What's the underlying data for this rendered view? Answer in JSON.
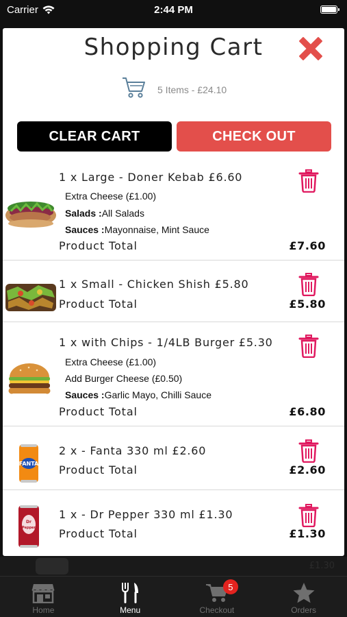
{
  "status_bar": {
    "carrier": "Carrier",
    "time": "2:44 PM"
  },
  "cart": {
    "title": "Shopping Cart",
    "summary": "5 Items - £24.10",
    "clear_label": "CLEAR CART",
    "checkout_label": "CHECK OUT"
  },
  "items": [
    {
      "title": "1 x Large - Doner Kebab £6.60",
      "options": [
        {
          "label": "",
          "value": "Extra Cheese (£1.00)"
        },
        {
          "label": "Salads :",
          "value": "All Salads"
        },
        {
          "label": "Sauces :",
          "value": "Mayonnaise, Mint Sauce"
        }
      ],
      "total_label": "Product Total",
      "total": "£7.60"
    },
    {
      "title": "1 x Small - Chicken Shish £5.80",
      "options": [],
      "total_label": "Product Total",
      "total": "£5.80"
    },
    {
      "title": "1 x with Chips - 1/4LB Burger £5.30",
      "options": [
        {
          "label": "",
          "value": "Extra Cheese (£1.00)"
        },
        {
          "label": "",
          "value": "Add Burger Cheese (£0.50)"
        },
        {
          "label": "Sauces :",
          "value": "Garlic Mayo, Chilli Sauce"
        }
      ],
      "total_label": "Product Total",
      "total": "£6.80"
    },
    {
      "title": "2 x - Fanta 330 ml £2.60",
      "options": [],
      "total_label": "Product Total",
      "total": "£2.60"
    },
    {
      "title": "1 x - Dr Pepper 330 ml £1.30",
      "options": [],
      "total_label": "Product Total",
      "total": "£1.30"
    }
  ],
  "background_peek": {
    "price": "£1.30"
  },
  "tabs": [
    {
      "label": "Home",
      "icon": "store-icon"
    },
    {
      "label": "Menu",
      "icon": "fork-knife-icon"
    },
    {
      "label": "Checkout",
      "icon": "cart-icon",
      "badge": "5"
    },
    {
      "label": "Orders",
      "icon": "star-icon"
    }
  ],
  "colors": {
    "accent": "#e34f4b",
    "trash": "#e0195f",
    "close": "#e34f4b"
  }
}
